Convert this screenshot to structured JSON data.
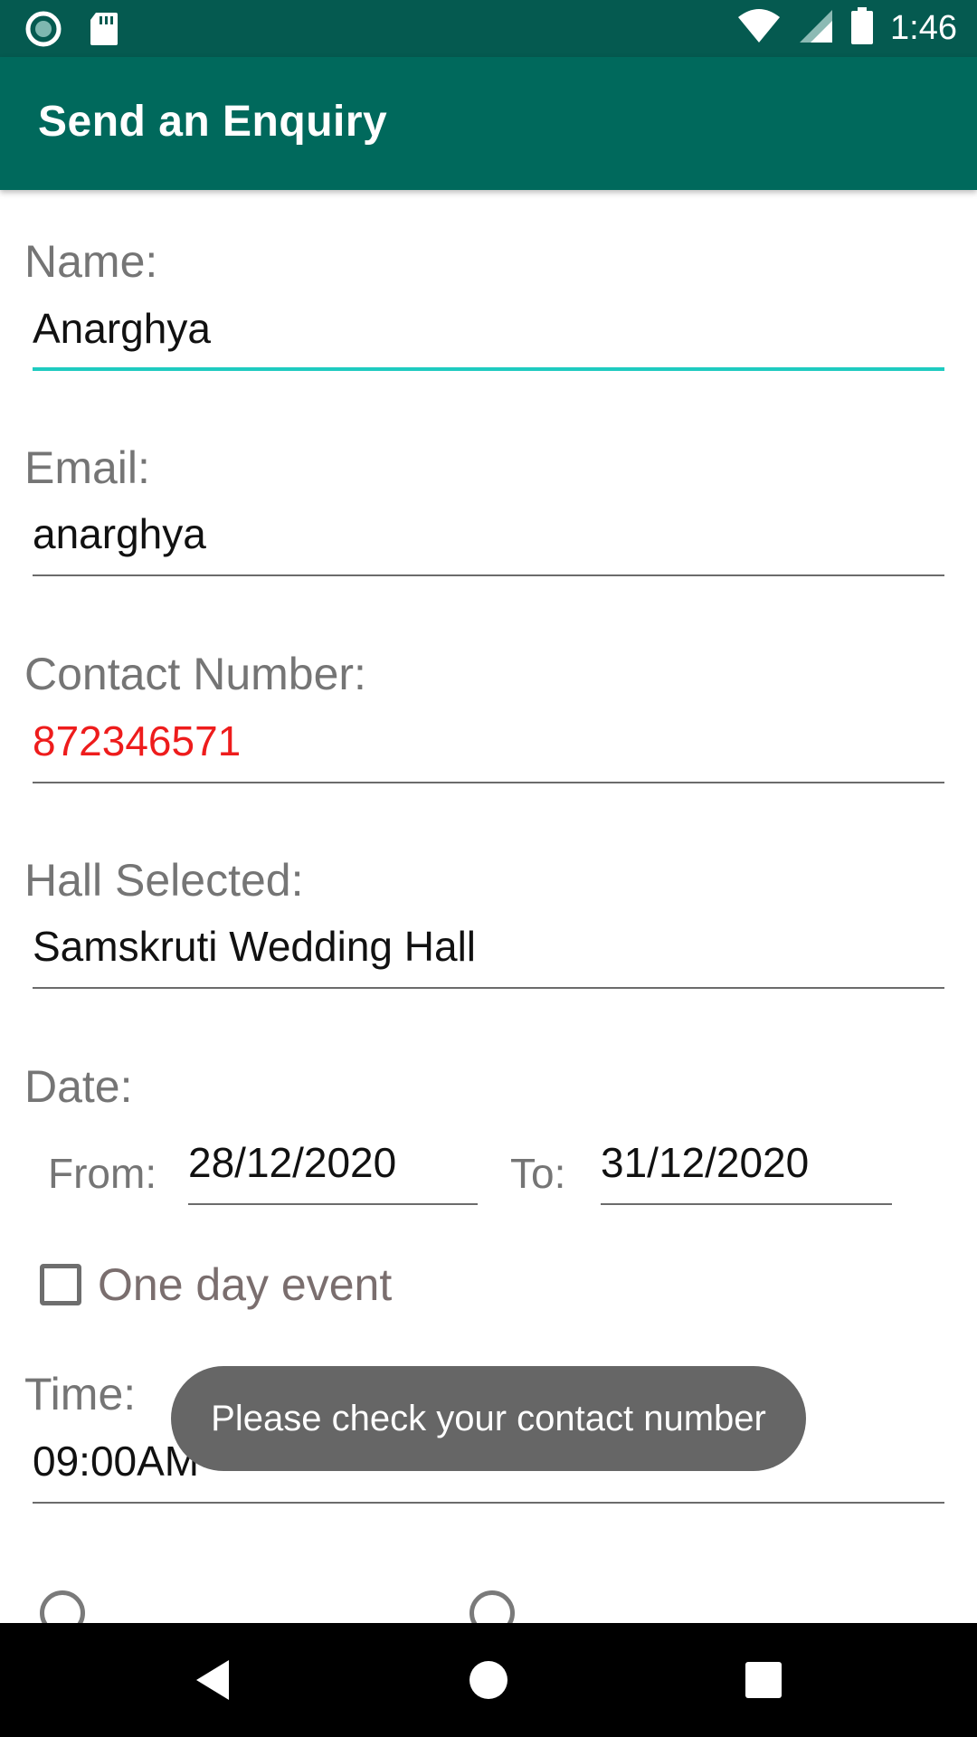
{
  "status_bar": {
    "time": "1:46",
    "icons": [
      "record-icon",
      "sd-card-icon",
      "wifi-icon",
      "signal-icon",
      "battery-icon"
    ]
  },
  "app_bar": {
    "title": "Send an Enquiry"
  },
  "form": {
    "name": {
      "label": "Name:",
      "value": "Anarghya"
    },
    "email": {
      "label": "Email:",
      "value": "anarghya"
    },
    "contact": {
      "label": "Contact Number:",
      "value": "872346571"
    },
    "hall": {
      "label": "Hall Selected:",
      "value": "Samskruti Wedding Hall"
    },
    "date": {
      "label": "Date:",
      "from_label": "From:",
      "from_value": "28/12/2020",
      "to_label": "To:",
      "to_value": "31/12/2020"
    },
    "one_day": {
      "label": "One day event",
      "checked": false
    },
    "time": {
      "label": "Time:",
      "value": "09:00AM"
    }
  },
  "toast": {
    "message": "Please check your contact number"
  },
  "colors": {
    "status_bar": "#055a50",
    "app_bar": "#00695c",
    "accent": "#1ecbc0",
    "error": "#ee1c1c"
  },
  "nav_bar": {
    "icons": [
      "back-icon",
      "home-icon",
      "recents-icon"
    ]
  }
}
